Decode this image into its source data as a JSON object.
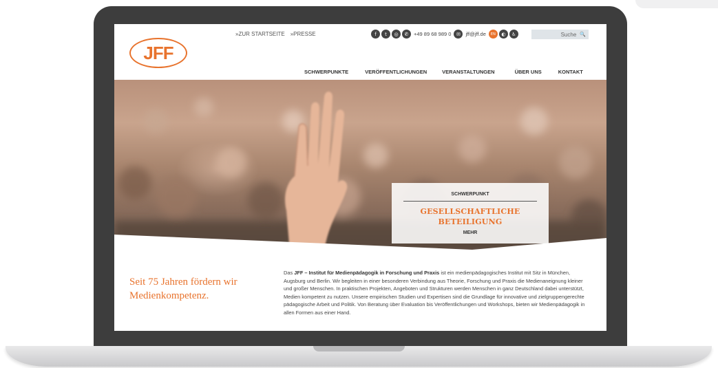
{
  "header": {
    "logo_text": "JFF",
    "top_links": [
      "»ZUR STARTSEITE",
      "»PRESSE"
    ],
    "phone": "+49 89 68 989 0",
    "email": "jff@jff.de",
    "lang": "EN",
    "search_placeholder": "Suche"
  },
  "nav": {
    "items": [
      "SCHWERPUNKTE",
      "VERÖFFENTLICHUNGEN",
      "VERANSTALTUNGEN",
      "ÜBER UNS",
      "KONTAKT"
    ]
  },
  "hero": {
    "kicker": "SCHWERPUNKT",
    "title_line1": "GESELLSCHAFTLICHE",
    "title_line2": "BETEILIGUNG",
    "more": "MEHR"
  },
  "intro": {
    "tagline": "Seit 75 Jahren fördern wir Medienkompetenz.",
    "lead_pre": "Das ",
    "lead_bold": "JFF – Institut für Medienpädagogik in Forschung und Praxis",
    "body": " ist ein medienpädagogisches Institut mit Sitz in München, Augsburg und Berlin. Wir begleiten in einer besonderen Verbindung aus Theorie, Forschung und Praxis die Medienaneignung kleiner und großer Menschen. In praktischen Projekten, Angeboten und Strukturen werden Menschen in ganz Deutschland dabei unterstützt, Medien kompetent zu nutzen. Unsere empirischen Studien und Expertisen sind die Grundlage für innovative und zielgruppengerechte pädagogische Arbeit und Politik. Von Beratung über Evaluation bis Veröffentlichungen und Workshops, bieten wir Medienpädagogik in allen Formen aus einer Hand."
  },
  "colors": {
    "accent": "#e8732d",
    "laptop_frame": "#3d3d3d",
    "text": "#444444"
  }
}
